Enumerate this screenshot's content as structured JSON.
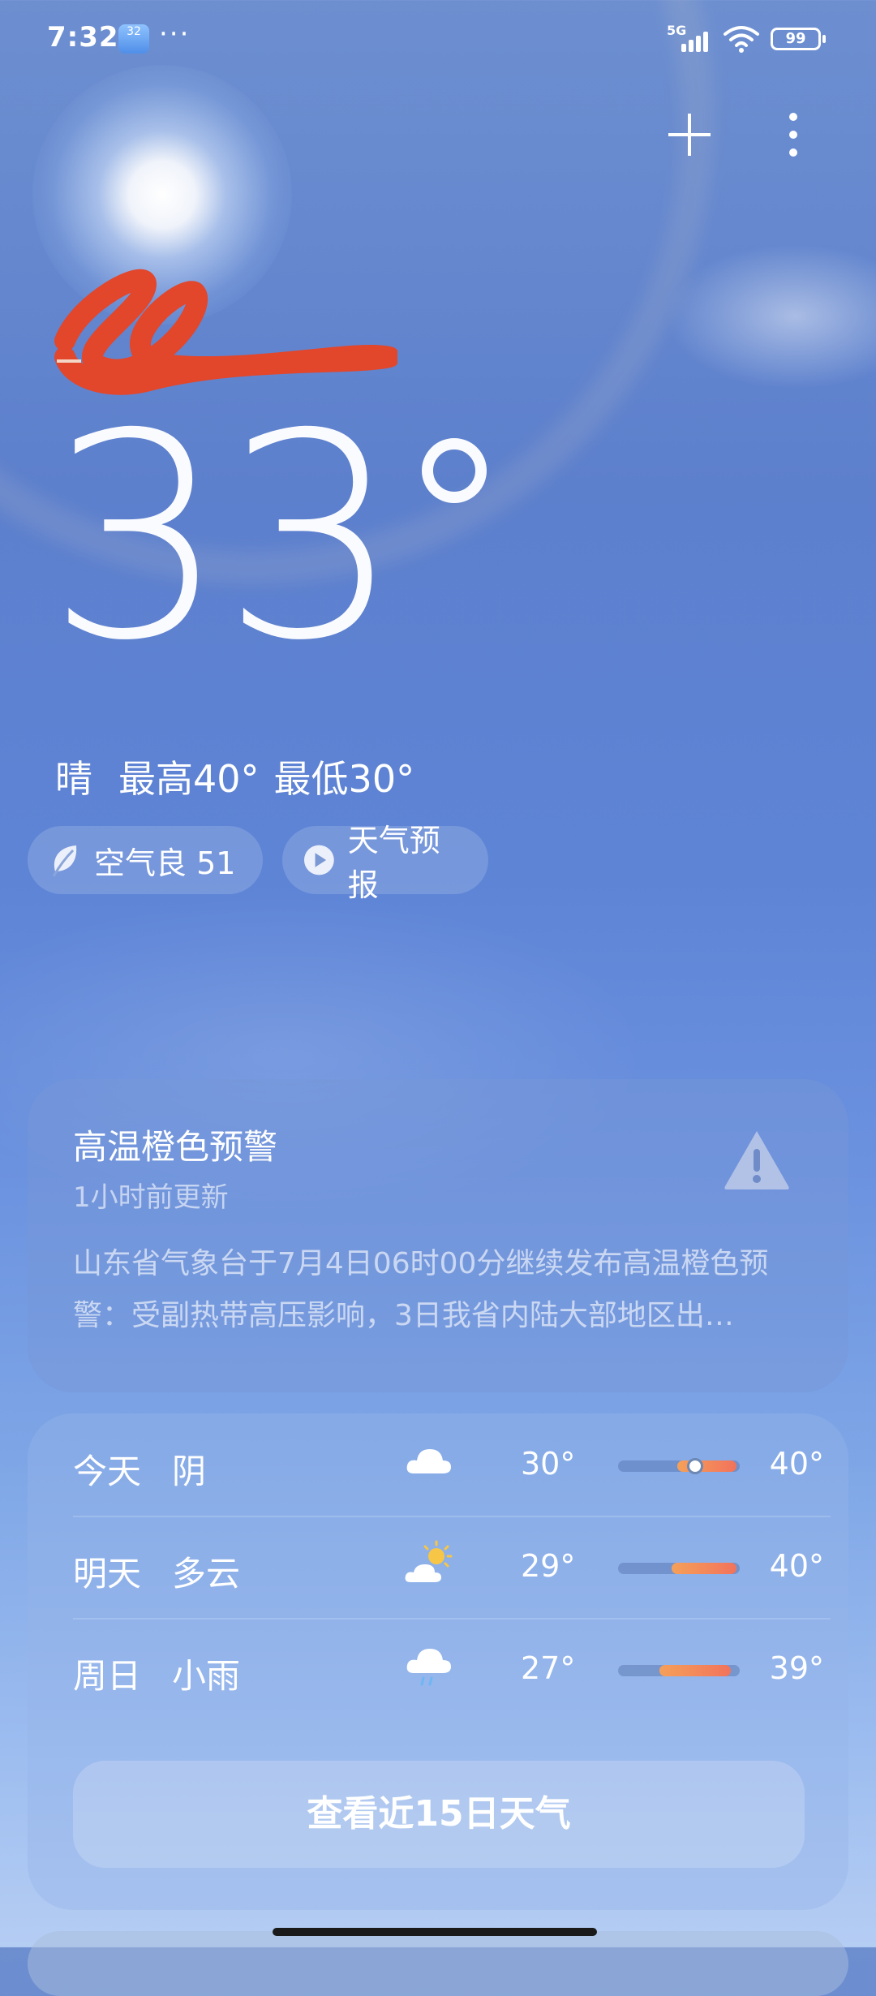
{
  "status_bar": {
    "time": "7:32",
    "app_badge": "32",
    "overflow": "···",
    "network": "5G",
    "battery": "99"
  },
  "header": {
    "add_icon": "plus-icon",
    "menu_icon": "more-vertical-icon"
  },
  "current": {
    "location": "",
    "temperature": "33",
    "condition": "晴",
    "high": "最高40°",
    "low": "最低30°"
  },
  "chips": {
    "air_quality": "空气良 51",
    "forecast_video": "天气预报"
  },
  "alert": {
    "title": "高温橙色预警",
    "updated": "1小时前更新",
    "body": "山东省气象台于7月4日06时00分继续发布高温橙色预警：受副热带高压影响，3日我省内陆大部地区出…",
    "icon": "warning-triangle-icon"
  },
  "forecast": {
    "days": [
      {
        "day": "今天",
        "condition": "阴",
        "icon": "cloudy-icon",
        "low": "30°",
        "high": "40°",
        "range_lo": 30,
        "range_hi": 40,
        "now": 33
      },
      {
        "day": "明天",
        "condition": "多云",
        "icon": "partly-cloudy-icon",
        "low": "29°",
        "high": "40°",
        "range_lo": 29,
        "range_hi": 40
      },
      {
        "day": "周日",
        "condition": "小雨",
        "icon": "light-rain-icon",
        "low": "27°",
        "high": "39°",
        "range_lo": 27,
        "range_hi": 39
      }
    ],
    "button": "查看近15日天气"
  },
  "colors": {
    "sky_top": "#6d8fd0",
    "sky_bottom": "#b5cdf3",
    "temp_bar": "#f2735b"
  }
}
